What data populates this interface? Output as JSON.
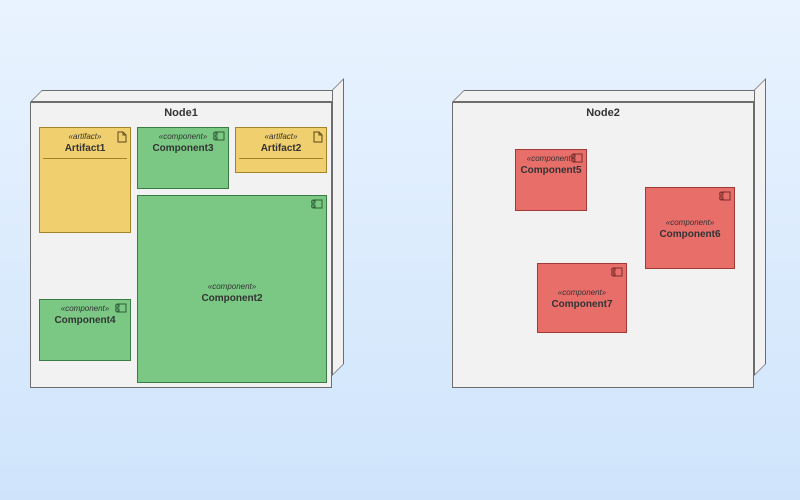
{
  "stereotypes": {
    "artifact": "«artifact»",
    "component": "«component»"
  },
  "nodes": {
    "node1": {
      "title": "Node1"
    },
    "node2": {
      "title": "Node2"
    }
  },
  "elements": {
    "artifact1": {
      "name": "Artifact1"
    },
    "artifact2": {
      "name": "Artifact2"
    },
    "component2": {
      "name": "Component2"
    },
    "component3": {
      "name": "Component3"
    },
    "component4": {
      "name": "Component4"
    },
    "component5": {
      "name": "Component5"
    },
    "component6": {
      "name": "Component6"
    },
    "component7": {
      "name": "Component7"
    }
  }
}
